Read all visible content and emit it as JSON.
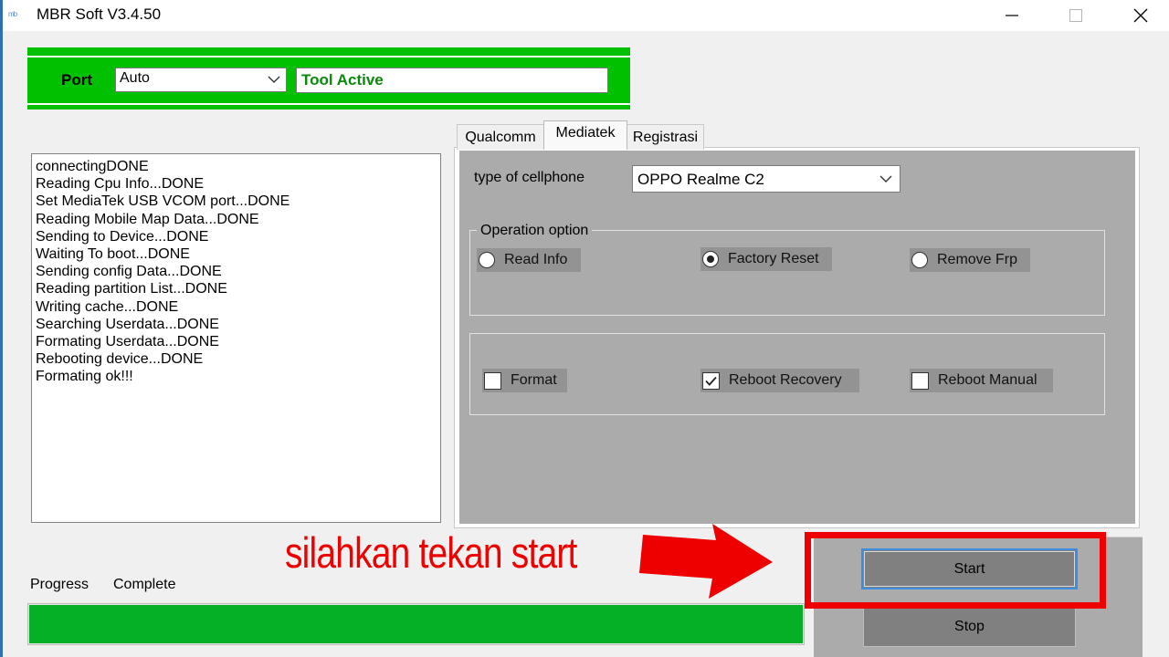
{
  "window": {
    "title": "MBR Soft V3.4.50",
    "icon": "app-logo-icon",
    "controls": [
      "minimize-icon",
      "maximize-icon",
      "close-icon"
    ]
  },
  "port_bar": {
    "port_label": "Port",
    "port_value": "Auto",
    "status": "Tool Active",
    "accent_color": "#00c000"
  },
  "log": {
    "lines": [
      "connectingDONE",
      "Reading Cpu Info...DONE",
      "Set MediaTek USB VCOM port...DONE",
      "Reading Mobile Map Data...DONE",
      "Sending to Device...DONE",
      "Waiting To boot...DONE",
      "Sending config Data...DONE",
      "Reading partition List...DONE",
      "Writing cache...DONE",
      "Searching Userdata...DONE",
      "Formating Userdata...DONE",
      "Rebooting device...DONE",
      "Formating ok!!!"
    ]
  },
  "tabs": [
    {
      "label": "Qualcomm",
      "active": false
    },
    {
      "label": "Mediatek",
      "active": true
    },
    {
      "label": "Registrasi",
      "active": false
    }
  ],
  "mediatek": {
    "type_label": "type of cellphone",
    "type_value": "OPPO Realme C2",
    "operation_legend": "Operation option",
    "radios": [
      {
        "label": "Read Info",
        "checked": false
      },
      {
        "label": "Factory Reset",
        "checked": true
      },
      {
        "label": "Remove Frp",
        "checked": false
      }
    ],
    "checkboxes": [
      {
        "label": "Format",
        "checked": false
      },
      {
        "label": "Reboot Recovery",
        "checked": true
      },
      {
        "label": "Reboot Manual",
        "checked": false
      }
    ]
  },
  "annotation": {
    "text": "silahkan tekan start",
    "color": "#ee0000"
  },
  "progress": {
    "label": "Progress",
    "status": "Complete",
    "percent": 100,
    "fill_color": "#06b025"
  },
  "actions": {
    "start_label": "Start",
    "stop_label": "Stop"
  }
}
